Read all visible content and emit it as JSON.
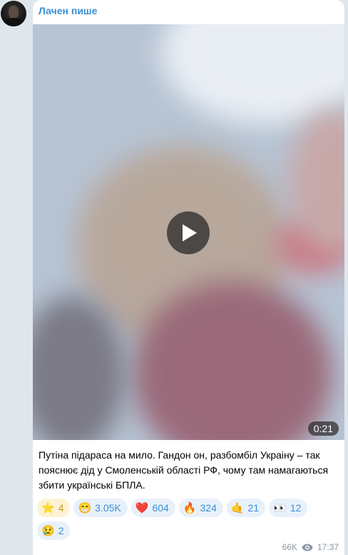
{
  "channel": {
    "name": "Лачен пише"
  },
  "video": {
    "duration": "0:21"
  },
  "caption": "Путіна підараса на мило. Гандон он, разбомбіл Украіну – так пояснює дід у Смоленській області РФ, чому там намагаються збити українські БПЛА.",
  "reactions": [
    {
      "emoji": "⭐",
      "count": "4",
      "paid": true
    },
    {
      "emoji": "😁",
      "count": "3.05K"
    },
    {
      "emoji": "❤️",
      "count": "604"
    },
    {
      "emoji": "🔥",
      "count": "324"
    },
    {
      "emoji": "🤙",
      "count": "21"
    },
    {
      "emoji": "👀",
      "count": "12"
    },
    {
      "emoji": "😢",
      "count": "2"
    }
  ],
  "meta": {
    "views": "66K",
    "time": "17:37"
  },
  "icons": {
    "play": "play-icon",
    "views": "eye-icon"
  }
}
